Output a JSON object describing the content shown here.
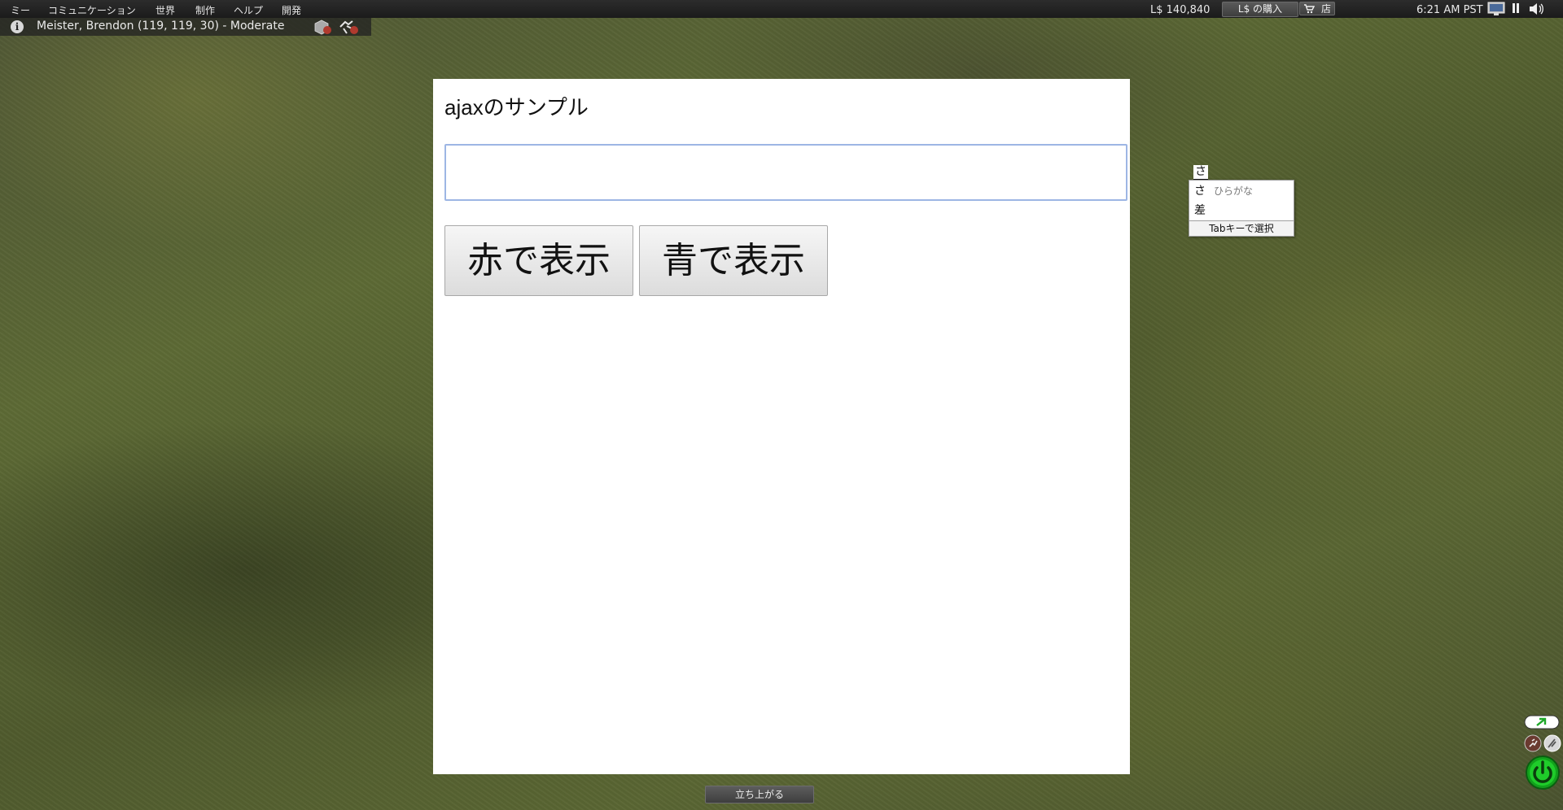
{
  "menubar": {
    "items": [
      {
        "label": "ミー"
      },
      {
        "label": "コミュニケーション"
      },
      {
        "label": "世界"
      },
      {
        "label": "制作"
      },
      {
        "label": "ヘルプ"
      },
      {
        "label": "開発"
      }
    ],
    "balance": "L$ 140,840",
    "buy_currency_label": "L$ の購入",
    "shop_label": "店",
    "clock": "6:21 AM PST"
  },
  "location": {
    "text": "Meister, Brendon (119, 119, 30) - Moderate"
  },
  "web_page": {
    "title": "ajaxのサンプル",
    "input_value": "",
    "buttons": {
      "red": "赤で表示",
      "blue": "青で表示"
    }
  },
  "ime": {
    "composition": "さ",
    "candidates": [
      {
        "text": "さ",
        "hint": "ひらがな"
      },
      {
        "text": "差",
        "hint": ""
      }
    ],
    "footer": "Tabキーで選択"
  },
  "standup_label": "立ち上がる",
  "colors": {
    "menubar_bg": "#1f1f1f",
    "input_focus_border": "#9db6e4",
    "power_green": "#1fcc2a"
  }
}
